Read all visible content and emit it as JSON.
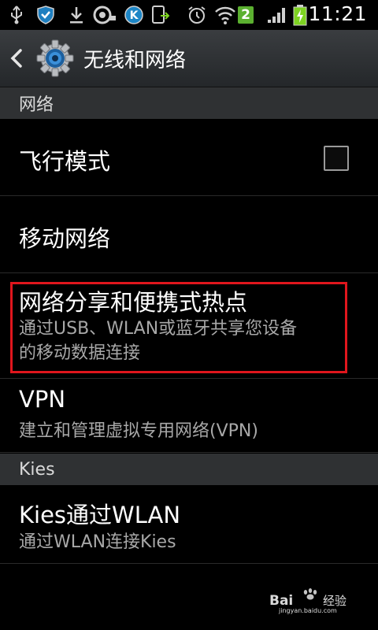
{
  "status_bar": {
    "time": "11:21",
    "notification_badge": "2",
    "icons": [
      "usb-icon",
      "shield-icon",
      "download-icon",
      "headset-icon",
      "k-app-icon",
      "screenshot-icon",
      "alarm-icon",
      "wifi-icon",
      "signal-icon",
      "battery-charging-icon"
    ],
    "colors": {
      "badge_bg": "#5bb030",
      "battery": "#7ed321"
    }
  },
  "action_bar": {
    "title": "无线和网络",
    "icons": [
      "back-arrow-icon",
      "settings-gear-icon"
    ]
  },
  "sections": [
    {
      "header": "网络",
      "items": [
        {
          "title": "飞行模式",
          "checked": false
        },
        {
          "title": "移动网络"
        },
        {
          "title": "网络分享和便携式热点",
          "subtitle_line1": "通过USB、WLAN或蓝牙共享您设备",
          "subtitle_line2": "的移动数据连接",
          "highlighted": true
        },
        {
          "title": "VPN",
          "subtitle": "建立和管理虚拟专用网络(VPN)"
        }
      ]
    },
    {
      "header": "Kies",
      "items": [
        {
          "title": "Kies通过WLAN",
          "subtitle": "通过WLAN连接Kies"
        }
      ]
    }
  ],
  "watermark": {
    "brand": "Bai",
    "brand_tail": "经验",
    "site": "jingyan.baidu.com"
  },
  "colors": {
    "highlight": "#e0161d",
    "section_header_bg": "#2f3133",
    "subtitle_text": "#a8a8a8",
    "action_bar_bg": "#2f3235"
  }
}
